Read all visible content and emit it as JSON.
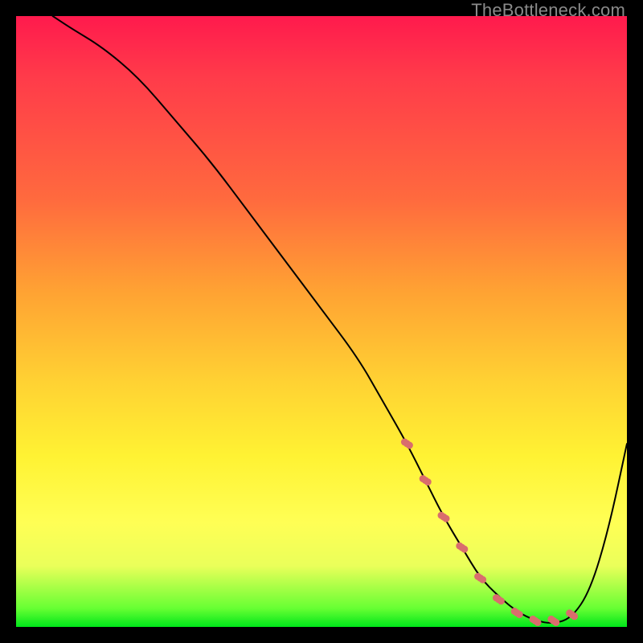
{
  "watermark": "TheBottleneck.com",
  "chart_data": {
    "type": "line",
    "title": "",
    "xlabel": "",
    "ylabel": "",
    "xlim": [
      0,
      100
    ],
    "ylim": [
      0,
      100
    ],
    "grid": false,
    "series": [
      {
        "name": "curve",
        "x": [
          6,
          9,
          14,
          20,
          26,
          32,
          38,
          44,
          50,
          56,
          60,
          64,
          67,
          70,
          73,
          76,
          79,
          82,
          85,
          88,
          91,
          94,
          97,
          100
        ],
        "y": [
          100,
          98,
          95,
          90,
          83,
          76,
          68,
          60,
          52,
          44,
          37,
          30,
          24,
          18,
          13,
          8,
          5,
          2.5,
          1,
          0.5,
          1.5,
          6,
          16,
          30
        ],
        "stroke": "#000000",
        "stroke_width": 2
      }
    ],
    "annotations": [
      {
        "name": "valley-dotted-band",
        "type": "dotted-segment",
        "x": [
          64,
          67,
          70,
          73,
          76,
          79,
          82,
          85,
          88,
          91
        ],
        "y": [
          30,
          24,
          18,
          13,
          8,
          4.5,
          2.3,
          1.0,
          1.0,
          2.0
        ],
        "color": "#d96d6d",
        "dot_radius": 4.5,
        "note": "salmon dotted markers along the bottom of the valley"
      }
    ]
  }
}
